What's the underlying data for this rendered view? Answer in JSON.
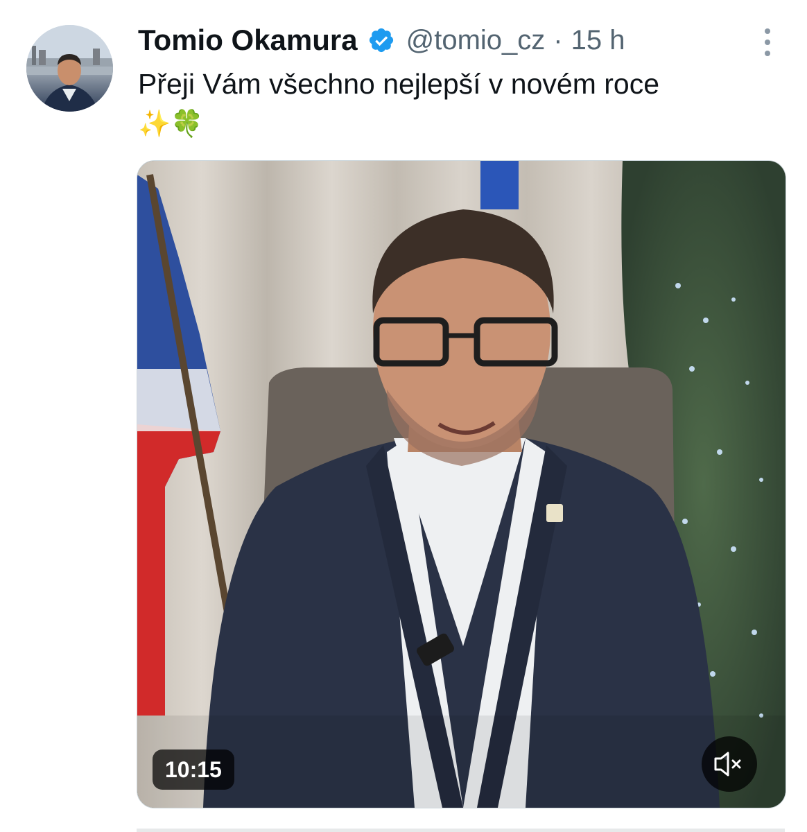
{
  "author": {
    "name": "Tomio Okamura",
    "handle": "@tomio_cz",
    "separator": "·",
    "time_ago": "15 h",
    "verified_color": "#1d9bf0"
  },
  "tweet": {
    "text_line1": "Přeji Vám všechno nejlepší v novém roce",
    "text_line2": "✨🍀"
  },
  "video": {
    "duration": "10:15",
    "muted": true
  },
  "icons": {
    "verified": "verified-badge-icon",
    "more": "more-options-icon",
    "mute": "speaker-muted-icon"
  }
}
